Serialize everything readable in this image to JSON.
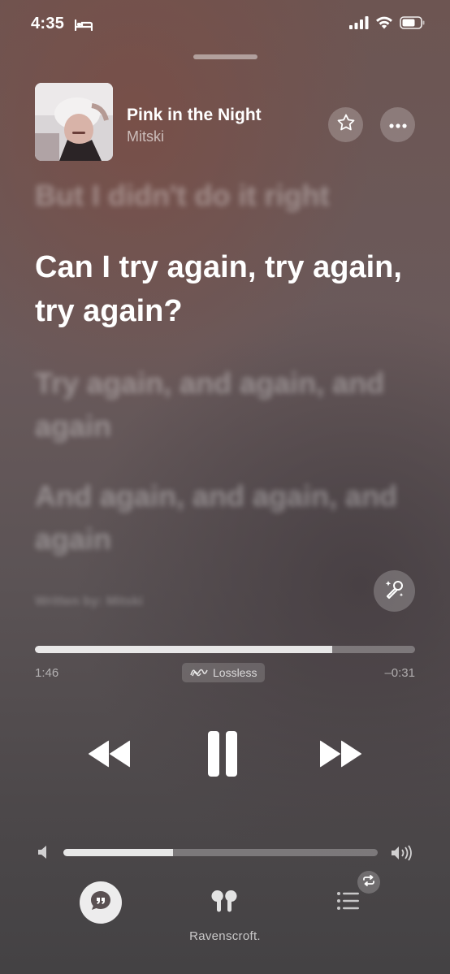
{
  "status": {
    "time": "4:35"
  },
  "now_playing": {
    "title": "Pink in the Night",
    "artist": "Mitski"
  },
  "lyrics": {
    "previous": "But I didn't do it right",
    "current": "Can I try again, try again, try again?",
    "next_1": "Try again, and again, and again",
    "next_2": "And again, and again, and again",
    "credit": "Written by: Mitski"
  },
  "playback": {
    "elapsed": "1:46",
    "remaining": "–0:31",
    "progress_fraction": 0.782,
    "quality_label": "Lossless",
    "volume_fraction": 0.35
  },
  "output": {
    "device_name": "Ravenscroft."
  },
  "colors": {
    "accent": "#ffffff",
    "background_top": "#6d5552",
    "background_bottom": "#444244"
  }
}
